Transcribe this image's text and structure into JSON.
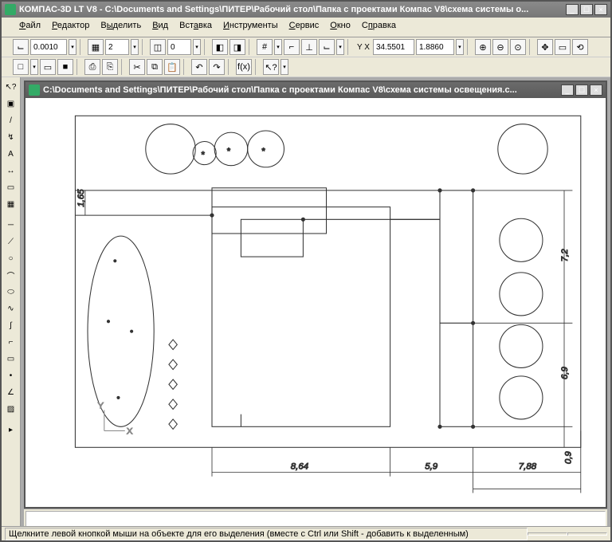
{
  "app": {
    "title": "КОМПАС-3D LT V8 - C:\\Documents and Settings\\ПИТЕР\\Рабочий стол\\Папка с проектами Компас V8\\схема системы о...",
    "min": "_",
    "max": "☐",
    "close": "×"
  },
  "menu": {
    "file": "Файл",
    "edit": "Редактор",
    "select": "Выделить",
    "view": "Вид",
    "insert": "Вставка",
    "tools": "Инструменты",
    "service": "Сервис",
    "window": "Окно",
    "help": "Справка"
  },
  "toolbar1": {
    "step_value": "0.0010",
    "layer_value": "2",
    "state_value": "0",
    "coord_x": "34.5501",
    "coord_y": "1.8860",
    "xy_label": "Y X"
  },
  "doc": {
    "title": "C:\\Documents and Settings\\ПИТЕР\\Рабочий стол\\Папка с проектами Компас V8\\схема системы освещения.c..."
  },
  "drawing": {
    "dims": {
      "left_v": "1,65",
      "h1": "8,64",
      "h2": "5,9",
      "h3": "7,88",
      "v1": "7,2",
      "v2": "6,9",
      "v3": "0,9"
    },
    "origin_x": "X",
    "origin_y": "Y"
  },
  "status": {
    "text": "Щелкните левой кнопкой мыши на объекте для его выделения (вместе с Ctrl или Shift - добавить к выделенным)"
  },
  "icons": {
    "grid": "#",
    "ortho": "⌐",
    "snap": "⌙",
    "perp": "⊥",
    "zoom_in": "⊕",
    "zoom_out": "⊖",
    "zoom_fit": "⊙",
    "pan": "✥",
    "rotate": "⟲",
    "window": "▭",
    "new": "□",
    "open": "▭",
    "save": "■",
    "print": "⎙",
    "preview": "⎘",
    "cut": "✂",
    "copy": "⧉",
    "paste": "📋",
    "undo": "↶",
    "redo": "↷",
    "fx": "f(x)",
    "cursor": "↖?",
    "line": "/",
    "circle": "○",
    "arc": "⌒",
    "spline": "∿",
    "text": "A",
    "dim": "↔",
    "point": "•",
    "rect": "▭",
    "poly": "⬠",
    "hatch": "▨",
    "fillet": "⌐",
    "chamfer": "∠",
    "ellipse": "⬭",
    "arrow": "▾",
    "eraser": "◧",
    "eraser2": "◨"
  }
}
